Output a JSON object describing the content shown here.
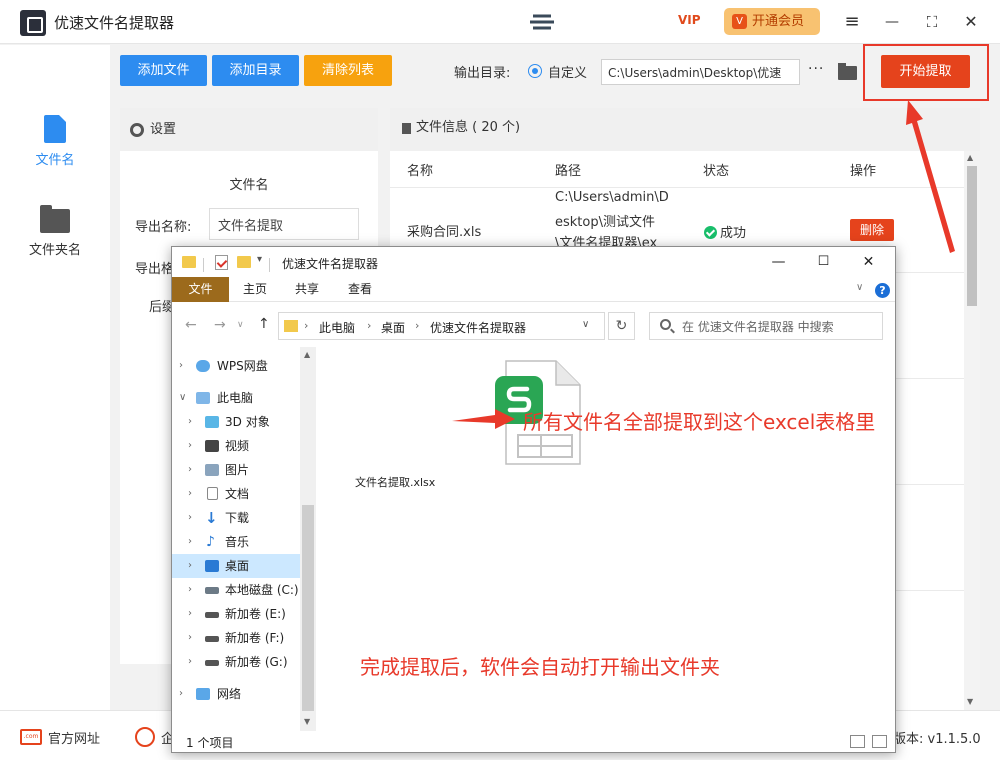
{
  "app": {
    "title": "优速文件名提取器",
    "vip_small": "VIP",
    "vip_label": "开通会员",
    "vip_crown": "V"
  },
  "window_controls": {
    "menu": "≡",
    "minimize": "—",
    "maximize": "⛶",
    "close": "✕"
  },
  "sidebar": {
    "items": [
      {
        "label": "文件名",
        "icon": "document-icon",
        "active": true
      },
      {
        "label": "文件夹名",
        "icon": "folder-icon",
        "active": false
      }
    ]
  },
  "toolbar": {
    "add_file": "添加文件",
    "add_dir": "添加目录",
    "clear_list": "清除列表",
    "output_label": "输出目录:",
    "output_option": "自定义",
    "output_path": "C:\\Users\\admin\\Desktop\\优速",
    "more": "···",
    "start": "开始提取"
  },
  "settings": {
    "header": "设置",
    "section_title": "文件名",
    "export_name_label": "导出名称:",
    "export_name_value": "文件名提取",
    "export_format_label": "导出格",
    "suffix_label": "后缀"
  },
  "file_info": {
    "header": "文件信息 ( 20 个)",
    "columns": [
      "名称",
      "路径",
      "状态",
      "操作"
    ],
    "rows": [
      {
        "name": "采购合同.xls",
        "path_lines": [
          "C:\\Users\\admin\\D",
          "esktop\\测试文件",
          "\\文件名提取器\\ex"
        ],
        "status": "成功",
        "action": "删除"
      }
    ]
  },
  "footer": {
    "website": "官方网址",
    "qq_partial": "企",
    "com_icon": ".com",
    "version": "版本: v1.1.5.0"
  },
  "explorer": {
    "title": "优速文件名提取器",
    "ribbon": {
      "file": "文件",
      "home": "主页",
      "share": "共享",
      "view": "查看"
    },
    "breadcrumb": [
      "此电脑",
      "桌面",
      "优速文件名提取器"
    ],
    "search_placeholder": "在 优速文件名提取器 中搜索",
    "tree": [
      {
        "label": "WPS网盘",
        "icon": "cloud-icon",
        "level": 0,
        "expanded": false,
        "selected": false
      },
      {
        "label": "此电脑",
        "icon": "computer-icon",
        "level": 0,
        "expanded": true,
        "selected": false
      },
      {
        "label": "3D 对象",
        "icon": "cube-icon",
        "level": 1,
        "expanded": false,
        "selected": false
      },
      {
        "label": "视频",
        "icon": "video-icon",
        "level": 1,
        "expanded": false,
        "selected": false
      },
      {
        "label": "图片",
        "icon": "picture-icon",
        "level": 1,
        "expanded": false,
        "selected": false
      },
      {
        "label": "文档",
        "icon": "document-icon",
        "level": 1,
        "expanded": false,
        "selected": false
      },
      {
        "label": "下载",
        "icon": "download-icon",
        "level": 1,
        "expanded": false,
        "selected": false
      },
      {
        "label": "音乐",
        "icon": "music-icon",
        "level": 1,
        "expanded": false,
        "selected": false
      },
      {
        "label": "桌面",
        "icon": "desktop-icon",
        "level": 1,
        "expanded": false,
        "selected": true
      },
      {
        "label": "本地磁盘 (C:)",
        "icon": "drive-icon",
        "level": 1,
        "expanded": false,
        "selected": false
      },
      {
        "label": "新加卷 (E:)",
        "icon": "drive-icon",
        "level": 1,
        "expanded": false,
        "selected": false
      },
      {
        "label": "新加卷 (F:)",
        "icon": "drive-icon",
        "level": 1,
        "expanded": false,
        "selected": false
      },
      {
        "label": "新加卷 (G:)",
        "icon": "drive-icon",
        "level": 1,
        "expanded": false,
        "selected": false
      },
      {
        "label": "网络",
        "icon": "network-icon",
        "level": 0,
        "expanded": false,
        "selected": false
      }
    ],
    "file": {
      "name": "文件名提取.xlsx",
      "icon": "xlsx-icon"
    },
    "status": "1 个项目"
  },
  "annotations": {
    "arrow_text": "所有文件名全部提取到这个excel表格里",
    "bottom_text": "完成提取后，软件会自动打开输出文件夹"
  },
  "colors": {
    "blue": "#2d8cf0",
    "orange": "#f7a20e",
    "start": "#e5431c",
    "annotation": "#e8392a",
    "wps_green": "#2aa654"
  }
}
